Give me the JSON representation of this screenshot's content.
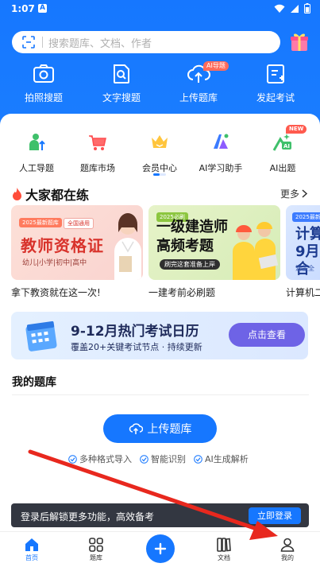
{
  "status_bar": {
    "time": "1:07",
    "a_icon": "A"
  },
  "search": {
    "placeholder": "搜索题库、文档、作者"
  },
  "top_features": [
    {
      "label": "拍照搜题",
      "icon": "camera-icon"
    },
    {
      "label": "文字搜题",
      "icon": "document-search-icon"
    },
    {
      "label": "上传题库",
      "icon": "cloud-upload-icon",
      "badge": "AI导题"
    },
    {
      "label": "发起考试",
      "icon": "exam-doc-icon"
    }
  ],
  "sub_features": [
    {
      "label": "人工导题",
      "icon": "person-upload-icon"
    },
    {
      "label": "题库市场",
      "icon": "cart-icon"
    },
    {
      "label": "会员中心",
      "icon": "crown-icon"
    },
    {
      "label": "AI学习助手",
      "icon": "ai-logo-icon"
    },
    {
      "label": "AI出题",
      "icon": "ai-generate-icon",
      "badge": "NEW"
    }
  ],
  "hot_section": {
    "title": "大家都在练",
    "more": "更多"
  },
  "banners": [
    {
      "tag1": "2025最新题库",
      "tag2": "全国通用",
      "title": "教师资格证",
      "subtitle": "幼儿|小学|初中|高中",
      "caption": "拿下教资就在这一次!"
    },
    {
      "tag1": "2025必刷",
      "title_line1": "一级建造师",
      "title_line2": "高频考题",
      "pill": "刷完这套准备上岸",
      "caption": "一建考前必刷题"
    },
    {
      "tag1": "2025最新",
      "title_line1": "计算",
      "title_line2": "9月合",
      "sub": "涵盖全",
      "caption": "计算机二"
    }
  ],
  "calendar_banner": {
    "title": "9-12月热门考试日历",
    "subtitle": "覆盖20+关键考试节点 · 持续更新",
    "button": "点击查看"
  },
  "my_bank": {
    "title": "我的题库",
    "upload_button": "上传题库",
    "tags": [
      "多种格式导入",
      "智能识别",
      "AI生成解析"
    ]
  },
  "login_prompt": {
    "text": "登录后解锁更多功能，高效备考",
    "button": "立即登录"
  },
  "bottom_nav": [
    {
      "label": "首页",
      "icon": "home-icon",
      "active": true
    },
    {
      "label": "题库",
      "icon": "grid-icon",
      "active": false
    },
    {
      "label": "文档",
      "icon": "books-icon",
      "active": false
    },
    {
      "label": "我的",
      "icon": "user-icon",
      "active": false
    }
  ],
  "colors": {
    "brand_blue": "#1677ff",
    "badge_red": "#ff5a4e",
    "annotation_arrow": "#e8281e"
  }
}
